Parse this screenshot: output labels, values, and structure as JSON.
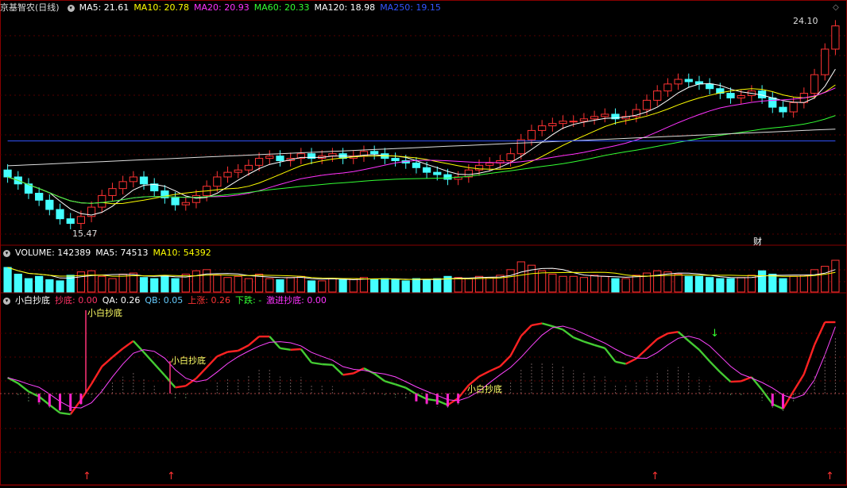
{
  "price_panel": {
    "title": "京基智农(日线)",
    "indicators": [
      {
        "label": "MA5: 21.61",
        "color": "#ffffff"
      },
      {
        "label": "MA10: 20.78",
        "color": "#ffff00"
      },
      {
        "label": "MA20: 20.93",
        "color": "#ff33ff"
      },
      {
        "label": "MA60: 20.33",
        "color": "#33ff33"
      },
      {
        "label": "MA120: 18.98",
        "color": "#ffffff"
      },
      {
        "label": "MA250: 19.15",
        "color": "#3355ff"
      }
    ],
    "high_label": "24.10",
    "low_label": "15.47",
    "fin_mark": "财"
  },
  "volume_panel": {
    "indicators": [
      {
        "label": "VOLUME: 142389",
        "color": "#ffffff"
      },
      {
        "label": "MA5: 74513",
        "color": "#ffffff"
      },
      {
        "label": "MA10: 54392",
        "color": "#ffff00"
      }
    ]
  },
  "signal_panel": {
    "indicators": [
      {
        "label": "小白抄底",
        "color": "#ffffff"
      },
      {
        "label": "抄底: 0.00",
        "color": "#ff3366"
      },
      {
        "label": "QA: 0.26",
        "color": "#ffffff"
      },
      {
        "label": "QB: 0.05",
        "color": "#66ccff"
      },
      {
        "label": "上涨: 0.26",
        "color": "#ff3333"
      },
      {
        "label": "下跌: -",
        "color": "#33ff33"
      },
      {
        "label": "激进抄底: 0.00",
        "color": "#ff33ff"
      }
    ],
    "signal_label": "小白抄底"
  },
  "chart_data": {
    "type": "candlestick",
    "y_range": [
      14.8,
      24.6
    ],
    "ma_levels": {
      "MA120": 18.98,
      "MA250": 19.15
    },
    "price_high": 24.1,
    "price_low": 15.47,
    "closes": [
      17.6,
      17.3,
      16.9,
      16.6,
      16.2,
      15.8,
      15.6,
      15.9,
      16.3,
      16.8,
      17.1,
      17.4,
      17.6,
      17.3,
      17.0,
      16.7,
      16.4,
      16.5,
      16.8,
      17.2,
      17.6,
      17.8,
      17.9,
      18.1,
      18.4,
      18.5,
      18.3,
      18.4,
      18.6,
      18.4,
      18.5,
      18.6,
      18.4,
      18.5,
      18.7,
      18.6,
      18.4,
      18.3,
      18.2,
      18.0,
      17.8,
      17.7,
      17.5,
      17.6,
      17.9,
      18.1,
      18.2,
      18.3,
      18.6,
      19.2,
      19.6,
      19.8,
      19.9,
      20.0,
      20.0,
      20.1,
      20.2,
      20.3,
      20.1,
      20.2,
      20.5,
      20.9,
      21.3,
      21.6,
      21.8,
      21.7,
      21.6,
      21.4,
      21.2,
      21.0,
      21.1,
      21.3,
      21.0,
      20.6,
      20.4,
      20.8,
      21.2,
      22.0,
      23.1,
      24.1
    ],
    "volumes": [
      110,
      80,
      60,
      70,
      55,
      50,
      75,
      90,
      95,
      70,
      60,
      80,
      85,
      65,
      60,
      70,
      60,
      80,
      95,
      100,
      75,
      65,
      70,
      60,
      80,
      60,
      55,
      65,
      70,
      50,
      50,
      60,
      55,
      60,
      65,
      55,
      60,
      55,
      50,
      60,
      55,
      60,
      70,
      65,
      60,
      70,
      65,
      75,
      100,
      135,
      120,
      95,
      80,
      70,
      70,
      65,
      75,
      70,
      60,
      60,
      75,
      85,
      95,
      90,
      80,
      70,
      70,
      65,
      60,
      60,
      65,
      75,
      95,
      80,
      60,
      70,
      75,
      100,
      115,
      142
    ]
  }
}
